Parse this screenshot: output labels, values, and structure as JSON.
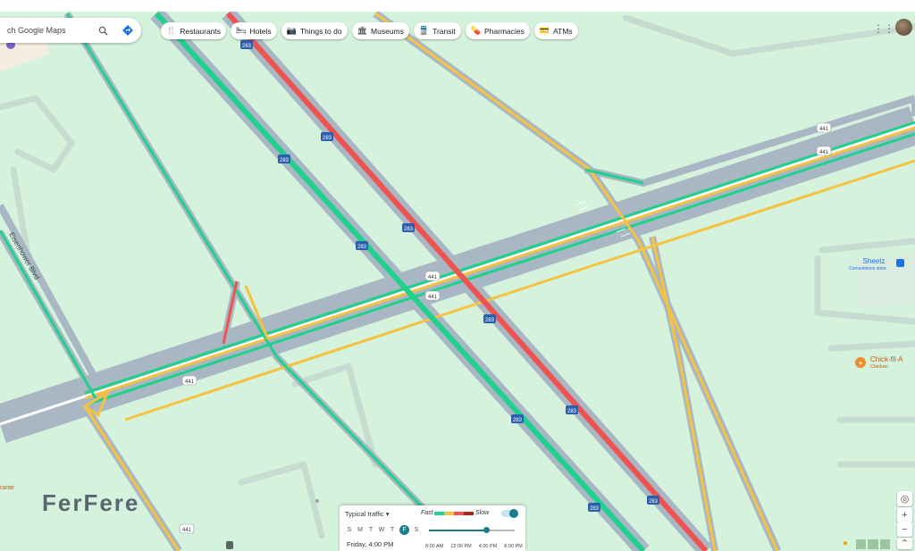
{
  "search": {
    "placeholder": "ch Google Maps"
  },
  "chips": [
    {
      "label": "Restaurants",
      "icon": "restaurant-icon"
    },
    {
      "label": "Hotels",
      "icon": "hotel-icon"
    },
    {
      "label": "Things to do",
      "icon": "camera-icon"
    },
    {
      "label": "Museums",
      "icon": "museum-icon"
    },
    {
      "label": "Transit",
      "icon": "transit-icon"
    },
    {
      "label": "Pharmacies",
      "icon": "pharmacy-icon"
    },
    {
      "label": "ATMs",
      "icon": "atm-icon"
    }
  ],
  "road_labels": {
    "i283": "283",
    "us441": "441",
    "street": "Eisenhower Blvd"
  },
  "places": {
    "sheetz": "Sheetz",
    "sheetz_sub": "Convenience store",
    "chick": "Chick-fil-A",
    "chick_sub": "Chicken",
    "cut_label": "rante"
  },
  "watermark": "FerFere",
  "traffic_panel": {
    "mode": "Typical traffic",
    "fast": "Fast",
    "slow": "Slow",
    "days": [
      "S",
      "M",
      "T",
      "W",
      "T",
      "F",
      "S"
    ],
    "selected_day_index": 5,
    "time": "Friday, 4:00 PM",
    "tick_labels": [
      "8:00 AM",
      "12:00 PM",
      "4:00 PM",
      "8:00 PM"
    ],
    "slider_value": "4:00 PM",
    "scale_colors": [
      "#1fd18c",
      "#f5c242",
      "#ef5350",
      "#a52714"
    ]
  },
  "controls": {
    "locate": "my-location-icon",
    "zoom_in": "+",
    "zoom_out": "−",
    "expand": "⌃"
  },
  "colors": {
    "map_background": "#d5f2dc",
    "road": "#a8b7c3",
    "traffic_fast": "#1fd18c",
    "traffic_medium": "#f5c242",
    "traffic_slow": "#ef5350"
  }
}
